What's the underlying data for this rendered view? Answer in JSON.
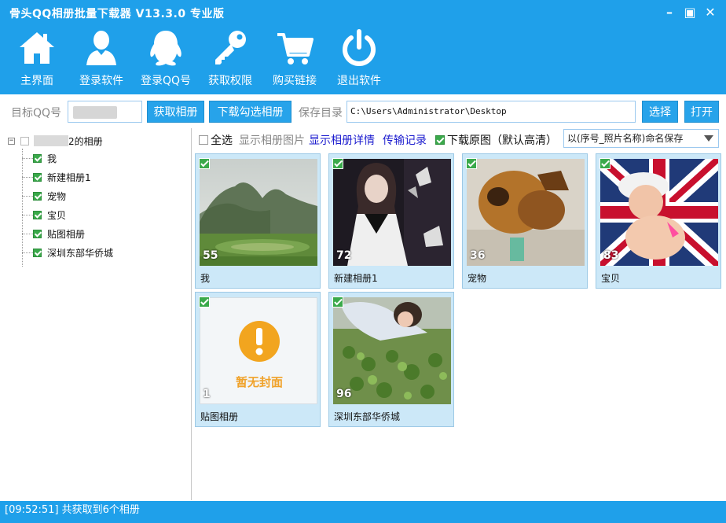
{
  "window": {
    "title": "骨头QQ相册批量下载器 V13.3.0 专业版",
    "controls": [
      "minimize",
      "maximize",
      "close"
    ]
  },
  "toolbar": {
    "items": [
      {
        "label": "主界面",
        "icon": "home-icon"
      },
      {
        "label": "登录软件",
        "icon": "user-icon"
      },
      {
        "label": "登录QQ号",
        "icon": "qq-penguin-icon"
      },
      {
        "label": "获取权限",
        "icon": "key-icon"
      },
      {
        "label": "购买链接",
        "icon": "cart-icon"
      },
      {
        "label": "退出软件",
        "icon": "power-icon"
      }
    ]
  },
  "controls": {
    "qq_label": "目标QQ号",
    "qq_value": "",
    "fetch_button": "获取相册",
    "download_button": "下载勾选相册",
    "save_label": "保存目录",
    "save_path": "C:\\Users\\Administrator\\Desktop",
    "choose_button": "选择",
    "open_button": "打开"
  },
  "tree": {
    "root_suffix": "2的相册",
    "items": [
      "我",
      "新建相册1",
      "宠物",
      "宝贝",
      "贴图相册",
      "深圳东部华侨城"
    ]
  },
  "options": {
    "select_all": "全选",
    "show_images": "显示相册图片",
    "show_details": "显示相册详情",
    "transfer_log": "传输记录",
    "download_original": "下载原图（默认高清）",
    "download_original_checked": true,
    "naming_select": "以(序号_照片名称)命名保存"
  },
  "albums": [
    {
      "name": "我",
      "count": "55"
    },
    {
      "name": "新建相册1",
      "count": "72"
    },
    {
      "name": "宠物",
      "count": "36"
    },
    {
      "name": "宝贝",
      "count": "83"
    },
    {
      "name": "贴图相册",
      "count": "1",
      "cover_text": "暂无封面"
    },
    {
      "name": "深圳东部华侨城",
      "count": "96"
    }
  ],
  "status": {
    "text": "[09:52:51]  共获取到6个相册"
  },
  "colors": {
    "primary": "#1fa0ea",
    "button": "#27a3ea",
    "card_bg": "#cce8f8",
    "check": "#3aa94a"
  }
}
